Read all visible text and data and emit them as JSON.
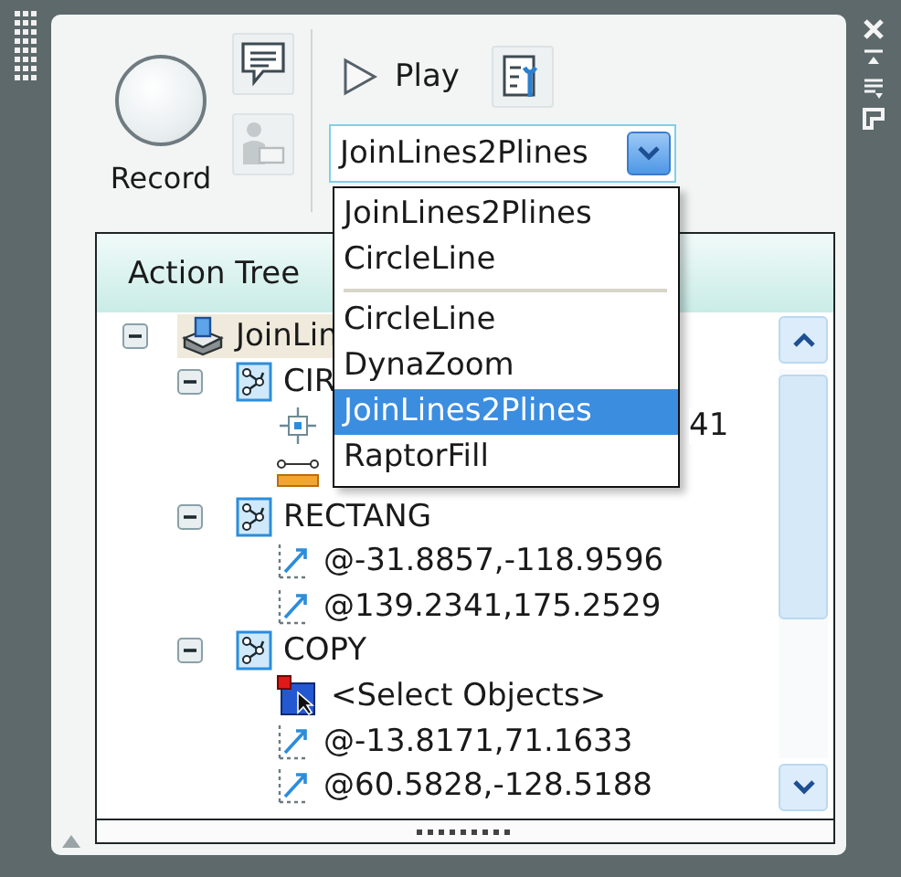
{
  "toolbar": {
    "record_label": "Record",
    "play_label": "Play",
    "macro_combo": {
      "value": "JoinLines2Plines"
    }
  },
  "macro_dropdown": {
    "items": [
      {
        "kind": "item",
        "label": "JoinLines2Plines",
        "selected": false
      },
      {
        "kind": "item",
        "label": "CircleLine",
        "selected": false
      },
      {
        "kind": "separator"
      },
      {
        "kind": "item",
        "label": "CircleLine",
        "selected": false
      },
      {
        "kind": "item",
        "label": "DynaZoom",
        "selected": false
      },
      {
        "kind": "item",
        "label": "JoinLines2Plines",
        "selected": true
      },
      {
        "kind": "item",
        "label": "RaptorFill",
        "selected": false
      }
    ]
  },
  "action_tree": {
    "title": "Action Tree",
    "nodes": [
      {
        "kind": "macro",
        "label": "JoinLin",
        "selected": true,
        "expanded": true,
        "children": [
          {
            "kind": "command",
            "label": "CIR",
            "selected": false,
            "expanded": true,
            "children": [
              {
                "kind": "point",
                "label": "41",
                "covered": true,
                "selected": false
              },
              {
                "kind": "distance",
                "selected": false
              }
            ]
          },
          {
            "kind": "command",
            "label": "RECTANG",
            "selected": false,
            "expanded": true,
            "children": [
              {
                "kind": "coordinate",
                "label": "@-31.8857,-118.9596",
                "selected": false
              },
              {
                "kind": "coordinate",
                "label": "@139.2341,175.2529",
                "selected": false
              }
            ]
          },
          {
            "kind": "command",
            "label": "COPY",
            "selected": false,
            "expanded": true,
            "children": [
              {
                "kind": "select",
                "label": "<Select Objects>",
                "selected": false
              },
              {
                "kind": "coordinate",
                "label": "@-13.8171,71.1633",
                "selected": false
              },
              {
                "kind": "coordinate",
                "label": "@60.5828,-128.5188",
                "selected": false
              }
            ]
          }
        ]
      }
    ]
  }
}
